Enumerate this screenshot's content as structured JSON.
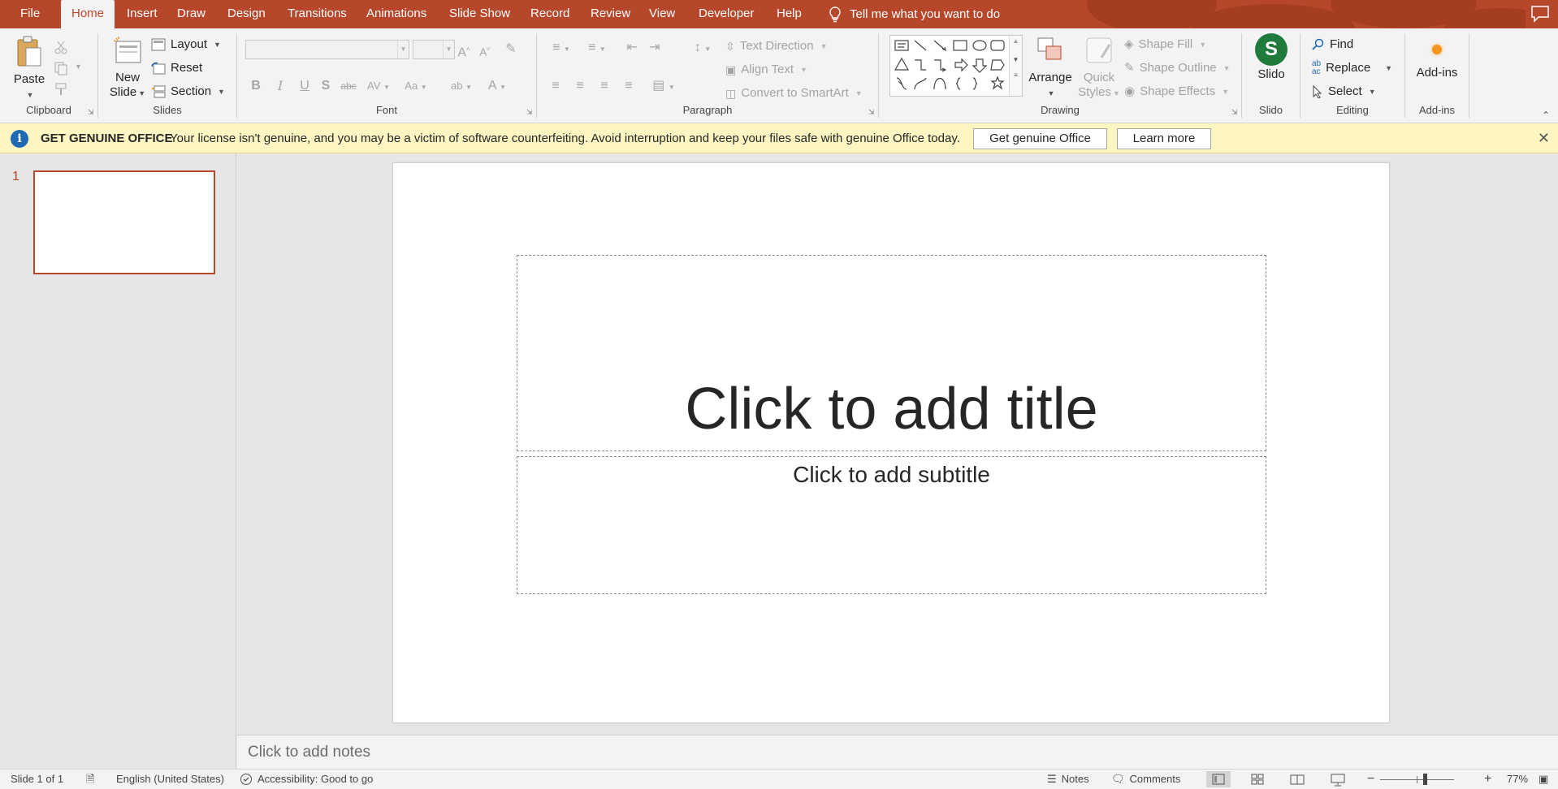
{
  "tabs": [
    "File",
    "Home",
    "Insert",
    "Draw",
    "Design",
    "Transitions",
    "Animations",
    "Slide Show",
    "Record",
    "Review",
    "View",
    "Developer",
    "Help"
  ],
  "active_tab": "Home",
  "tell_me": "Tell me what you want to do",
  "ribbon": {
    "clipboard": {
      "label": "Clipboard",
      "paste": "Paste"
    },
    "slides": {
      "label": "Slides",
      "new_slide_1": "New",
      "new_slide_2": "Slide",
      "layout": "Layout",
      "reset": "Reset",
      "section": "Section"
    },
    "font": {
      "label": "Font"
    },
    "paragraph": {
      "label": "Paragraph",
      "text_direction": "Text Direction",
      "align_text": "Align Text",
      "convert_smartart": "Convert to SmartArt"
    },
    "drawing": {
      "label": "Drawing",
      "arrange": "Arrange",
      "quick_styles_1": "Quick",
      "quick_styles_2": "Styles",
      "shape_fill": "Shape Fill",
      "shape_outline": "Shape Outline",
      "shape_effects": "Shape Effects"
    },
    "slido": {
      "label": "Slido",
      "button": "Slido"
    },
    "editing": {
      "label": "Editing",
      "find": "Find",
      "replace": "Replace",
      "select": "Select"
    },
    "addins": {
      "label": "Add-ins",
      "button": "Add-ins"
    }
  },
  "notification": {
    "heading": "GET GENUINE OFFICE",
    "message": "Your license isn't genuine, and you may be a victim of software counterfeiting. Avoid interruption and keep your files safe with genuine Office today.",
    "primary_button": "Get genuine Office",
    "secondary_button": "Learn more"
  },
  "thumbnails": {
    "slide_number": "1"
  },
  "slide": {
    "title_placeholder": "Click to add title",
    "subtitle_placeholder": "Click to add subtitle"
  },
  "notes_placeholder": "Click to add notes",
  "status": {
    "slide_count": "Slide 1 of 1",
    "language": "English (United States)",
    "accessibility": "Accessibility: Good to go",
    "notes": "Notes",
    "comments": "Comments",
    "zoom": "77%",
    "zoom_fraction": 0.6
  },
  "colors": {
    "accent": "#b7472a",
    "notify_bg": "#fdf6c3",
    "slido": "#1e7b3c"
  }
}
